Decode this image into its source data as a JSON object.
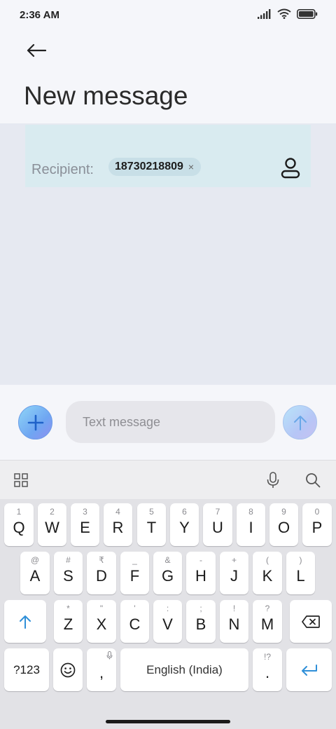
{
  "status_bar": {
    "time": "2:36 AM"
  },
  "header": {
    "title": "New message"
  },
  "recipient": {
    "label": "Recipient:",
    "chip_number": "18730218809",
    "chip_close": "×"
  },
  "compose": {
    "placeholder": "Text message"
  },
  "keyboard": {
    "row1": [
      {
        "label": "Q",
        "hint": "1"
      },
      {
        "label": "W",
        "hint": "2"
      },
      {
        "label": "E",
        "hint": "3"
      },
      {
        "label": "R",
        "hint": "4"
      },
      {
        "label": "T",
        "hint": "5"
      },
      {
        "label": "Y",
        "hint": "6"
      },
      {
        "label": "U",
        "hint": "7"
      },
      {
        "label": "I",
        "hint": "8"
      },
      {
        "label": "O",
        "hint": "9"
      },
      {
        "label": "P",
        "hint": "0"
      }
    ],
    "row2": [
      {
        "label": "A",
        "hint": "@"
      },
      {
        "label": "S",
        "hint": "#"
      },
      {
        "label": "D",
        "hint": "₹"
      },
      {
        "label": "F",
        "hint": "_"
      },
      {
        "label": "G",
        "hint": "&"
      },
      {
        "label": "H",
        "hint": "-"
      },
      {
        "label": "J",
        "hint": "+"
      },
      {
        "label": "K",
        "hint": "("
      },
      {
        "label": "L",
        "hint": ")"
      }
    ],
    "row3": [
      {
        "label": "Z",
        "hint": "*"
      },
      {
        "label": "X",
        "hint": "\""
      },
      {
        "label": "C",
        "hint": "'"
      },
      {
        "label": "V",
        "hint": ":"
      },
      {
        "label": "B",
        "hint": ";"
      },
      {
        "label": "N",
        "hint": "!"
      },
      {
        "label": "M",
        "hint": "?"
      }
    ],
    "symbols_key": "?123",
    "comma_key": ",",
    "space_key": "English (India)",
    "period_key": ".",
    "period_hint": "!?"
  },
  "colors": {
    "accent": "#2f8fd8",
    "recipient_bg": "#d9ebf0",
    "background": "#e6e9f1"
  },
  "icons": [
    "signal-icon",
    "wifi-icon",
    "battery-icon",
    "back-arrow-icon",
    "contact-icon",
    "plus-icon",
    "send-arrow-icon",
    "apps-grid-icon",
    "microphone-icon",
    "search-icon",
    "shift-icon",
    "backspace-icon",
    "emoji-icon",
    "enter-icon"
  ]
}
